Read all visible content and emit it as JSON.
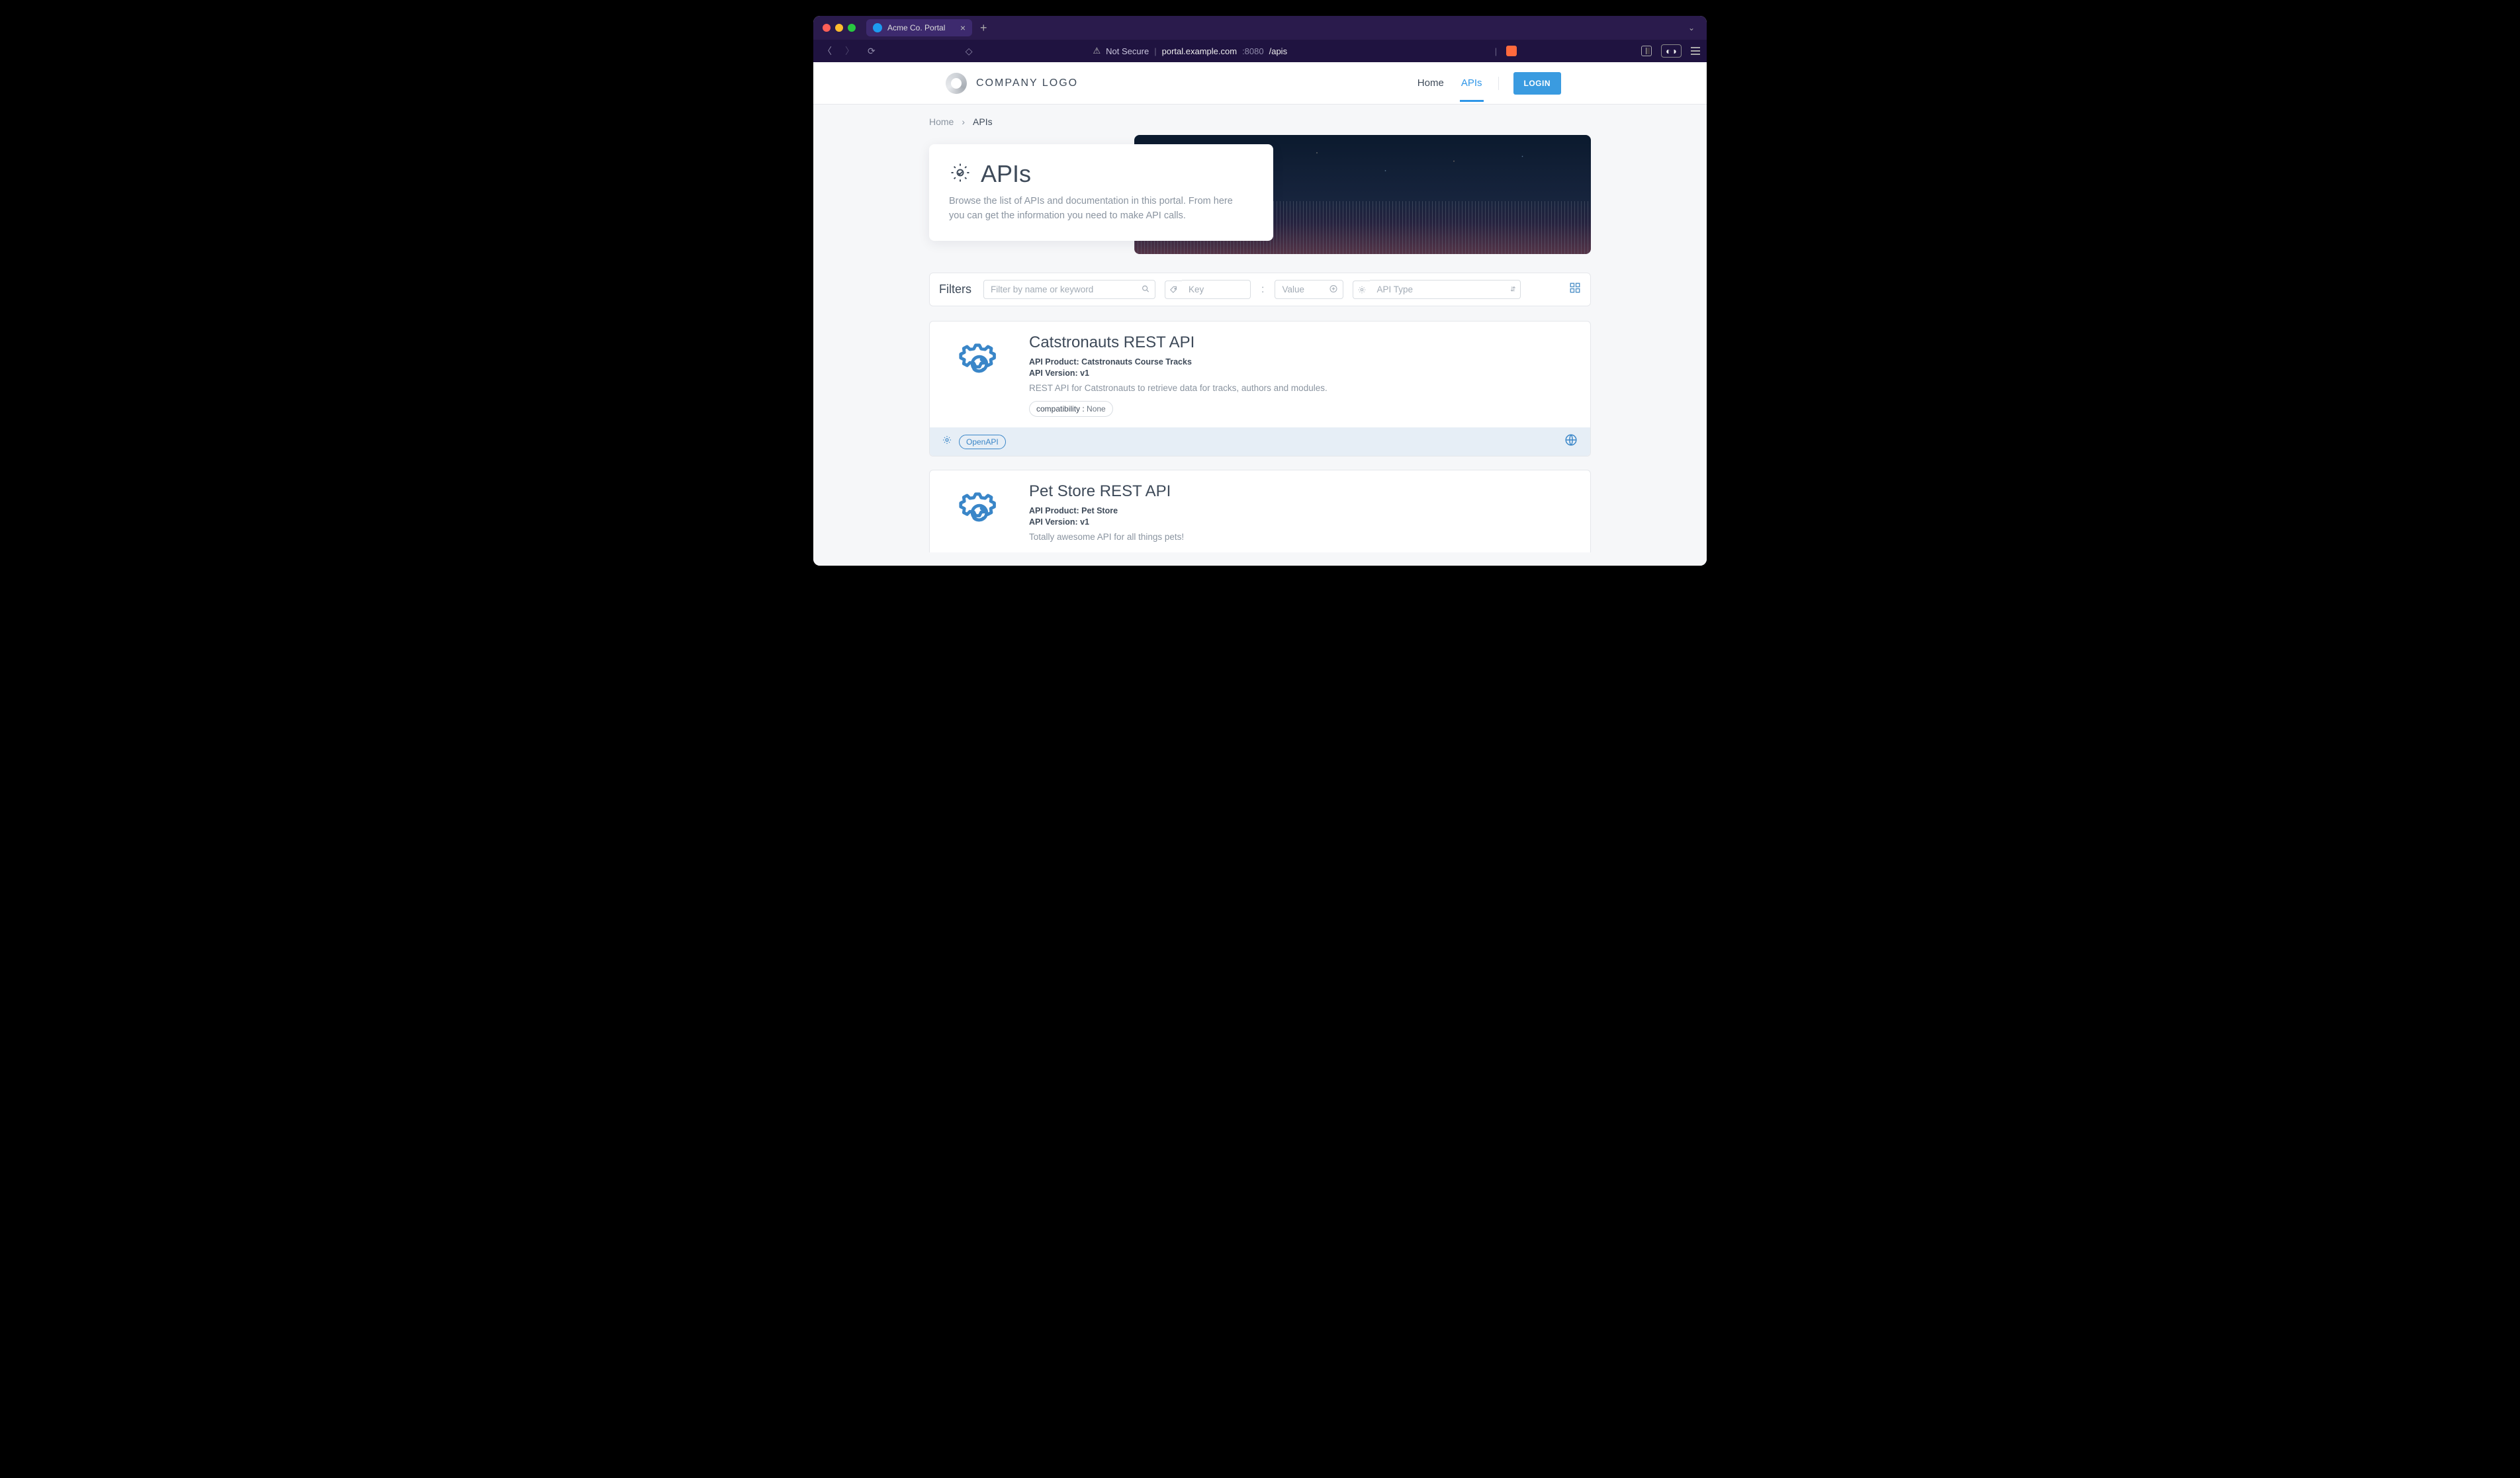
{
  "browser": {
    "tab_title": "Acme Co. Portal",
    "not_secure_label": "Not Secure",
    "url_host": "portal.example.com",
    "url_port": ":8080",
    "url_path": "/apis"
  },
  "topnav": {
    "logo_text": "COMPANY LOGO",
    "links": {
      "home": "Home",
      "apis": "APIs"
    },
    "login_label": "LOGIN"
  },
  "breadcrumb": {
    "home": "Home",
    "current": "APIs"
  },
  "hero": {
    "title": "APIs",
    "description": "Browse the list of APIs and documentation in this portal. From here you can get the information you need to make API calls."
  },
  "filters": {
    "label": "Filters",
    "name_placeholder": "Filter by name or keyword",
    "key_placeholder": "Key",
    "value_placeholder": "Value",
    "apitype_placeholder": "API Type"
  },
  "cards": [
    {
      "title": "Catstronauts REST API",
      "product_line": "API Product: Catstronauts Course Tracks",
      "version_line": "API Version: v1",
      "description": "REST API for Catstronauts to retrieve data for tracks, authors and modules.",
      "tag_key": "compatibility :",
      "tag_val": " None",
      "spec": "OpenAPI"
    },
    {
      "title": "Pet Store REST API",
      "product_line": "API Product: Pet Store",
      "version_line": "API Version: v1",
      "description": "Totally awesome API for all things pets!"
    }
  ]
}
